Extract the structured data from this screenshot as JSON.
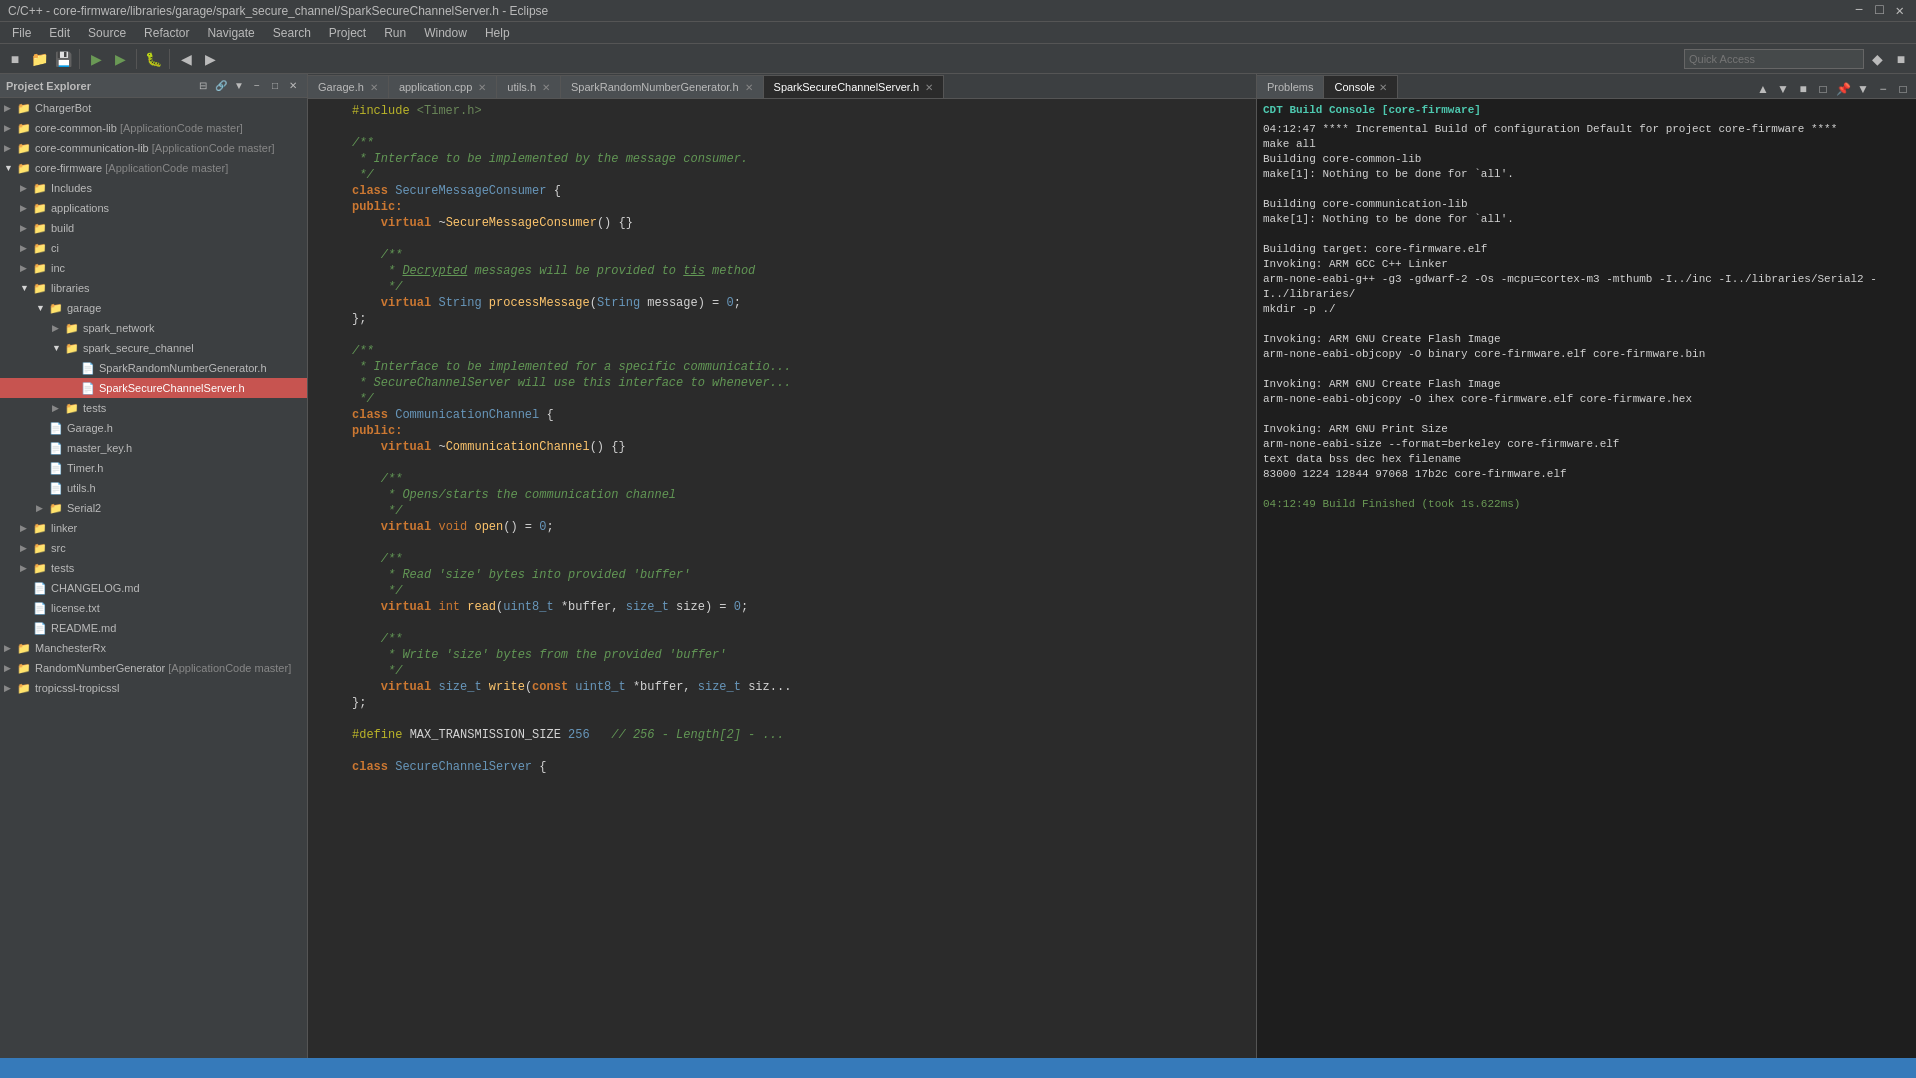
{
  "titleBar": {
    "text": "C/C++ - core-firmware/libraries/garage/spark_secure_channel/SparkSecureChannelServer.h - Eclipse",
    "controls": [
      "minimize",
      "maximize",
      "close"
    ]
  },
  "menuBar": {
    "items": [
      "File",
      "Edit",
      "Source",
      "Refactor",
      "Navigate",
      "Search",
      "Project",
      "Run",
      "Window",
      "Help"
    ]
  },
  "quickAccess": {
    "placeholder": "Quick Access"
  },
  "projectExplorer": {
    "title": "Project Explorer",
    "items": [
      {
        "label": "ChargerBot",
        "indent": 0,
        "type": "project",
        "expanded": false
      },
      {
        "label": "core-common-lib [ApplicationCode master]",
        "indent": 0,
        "type": "project",
        "expanded": false
      },
      {
        "label": "core-communication-lib [ApplicationCode master]",
        "indent": 0,
        "type": "project",
        "expanded": false
      },
      {
        "label": "core-firmware [ApplicationCode master]",
        "indent": 0,
        "type": "project",
        "expanded": true
      },
      {
        "label": "Includes",
        "indent": 1,
        "type": "folder",
        "expanded": false
      },
      {
        "label": "applications",
        "indent": 1,
        "type": "folder",
        "expanded": false
      },
      {
        "label": "build",
        "indent": 1,
        "type": "folder",
        "expanded": false
      },
      {
        "label": "ci",
        "indent": 1,
        "type": "folder",
        "expanded": false
      },
      {
        "label": "inc",
        "indent": 1,
        "type": "folder",
        "expanded": false
      },
      {
        "label": "libraries",
        "indent": 1,
        "type": "folder",
        "expanded": true
      },
      {
        "label": "garage",
        "indent": 2,
        "type": "folder",
        "expanded": true
      },
      {
        "label": "spark_network",
        "indent": 3,
        "type": "folder",
        "expanded": false
      },
      {
        "label": "spark_secure_channel",
        "indent": 3,
        "type": "folder",
        "expanded": true
      },
      {
        "label": "SparkRandomNumberGenerator.h",
        "indent": 4,
        "type": "file-h"
      },
      {
        "label": "SparkSecureChannelServer.h",
        "indent": 4,
        "type": "file-h",
        "active": true
      },
      {
        "label": "tests",
        "indent": 3,
        "type": "folder",
        "expanded": false
      },
      {
        "label": "Garage.h",
        "indent": 2,
        "type": "file-h"
      },
      {
        "label": "master_key.h",
        "indent": 2,
        "type": "file-h"
      },
      {
        "label": "Timer.h",
        "indent": 2,
        "type": "file-h"
      },
      {
        "label": "utils.h",
        "indent": 2,
        "type": "file-h"
      },
      {
        "label": "Serial2",
        "indent": 2,
        "type": "folder",
        "expanded": false
      },
      {
        "label": "linker",
        "indent": 1,
        "type": "folder",
        "expanded": false
      },
      {
        "label": "src",
        "indent": 1,
        "type": "folder",
        "expanded": false
      },
      {
        "label": "tests",
        "indent": 1,
        "type": "folder",
        "expanded": false
      },
      {
        "label": "CHANGELOG.md",
        "indent": 1,
        "type": "file"
      },
      {
        "label": "license.txt",
        "indent": 1,
        "type": "file"
      },
      {
        "label": "README.md",
        "indent": 1,
        "type": "file"
      },
      {
        "label": "ManchesterRx",
        "indent": 0,
        "type": "project",
        "expanded": false
      },
      {
        "label": "RandomNumberGenerator [ApplicationCode master]",
        "indent": 0,
        "type": "project",
        "expanded": false
      },
      {
        "label": "tropicssl-tropicssl",
        "indent": 0,
        "type": "project",
        "expanded": false
      }
    ]
  },
  "editorTabs": [
    {
      "label": "Garage.h",
      "active": false
    },
    {
      "label": "application.cpp",
      "active": false
    },
    {
      "label": "utils.h",
      "active": false
    },
    {
      "label": "SparkRandomNumberGenerator.h",
      "active": false
    },
    {
      "label": "SparkSecureChannelServer.h",
      "active": true
    }
  ],
  "codeLines": [
    {
      "num": "",
      "content": "#include <Timer.h>"
    },
    {
      "num": "",
      "content": ""
    },
    {
      "num": "",
      "content": "/**"
    },
    {
      "num": "",
      "content": " * Interface to be implemented by the message consumer."
    },
    {
      "num": "",
      "content": " */"
    },
    {
      "num": "",
      "content": "class SecureMessageConsumer {"
    },
    {
      "num": "",
      "content": "public:"
    },
    {
      "num": "",
      "content": "    virtual ~SecureMessageConsumer() {}"
    },
    {
      "num": "",
      "content": ""
    },
    {
      "num": "",
      "content": "    /**"
    },
    {
      "num": "",
      "content": "     * Decrypted messages will be provided to tis method"
    },
    {
      "num": "",
      "content": "     */"
    },
    {
      "num": "",
      "content": "    virtual String processMessage(String message) = 0;"
    },
    {
      "num": "",
      "content": "};"
    },
    {
      "num": "",
      "content": ""
    },
    {
      "num": "",
      "content": "/**"
    },
    {
      "num": "",
      "content": " * Interface to be implemented for a specific communicatio..."
    },
    {
      "num": "",
      "content": " * SecureChannelServer will use this interface to whenever..."
    },
    {
      "num": "",
      "content": " */"
    },
    {
      "num": "",
      "content": "class CommunicationChannel {"
    },
    {
      "num": "",
      "content": "public:"
    },
    {
      "num": "",
      "content": "    virtual ~CommunicationChannel() {}"
    },
    {
      "num": "",
      "content": ""
    },
    {
      "num": "",
      "content": "    /**"
    },
    {
      "num": "",
      "content": "     * Opens/starts the communication channel"
    },
    {
      "num": "",
      "content": "     */"
    },
    {
      "num": "",
      "content": "    virtual void open() = 0;"
    },
    {
      "num": "",
      "content": ""
    },
    {
      "num": "",
      "content": "    /**"
    },
    {
      "num": "",
      "content": "     * Read 'size' bytes into provided 'buffer'"
    },
    {
      "num": "",
      "content": "     */"
    },
    {
      "num": "",
      "content": "    virtual int read(uint8_t *buffer, size_t size) = 0;"
    },
    {
      "num": "",
      "content": ""
    },
    {
      "num": "",
      "content": "    /**"
    },
    {
      "num": "",
      "content": "     * Write 'size' bytes from the provided 'buffer'"
    },
    {
      "num": "",
      "content": "     */"
    },
    {
      "num": "",
      "content": "    virtual size_t write(const uint8_t *buffer, size_t siz..."
    },
    {
      "num": "",
      "content": "};"
    },
    {
      "num": "",
      "content": ""
    },
    {
      "num": "",
      "content": "#define MAX_TRANSMISSION_SIZE 256   // 256 - Length[2] - ..."
    },
    {
      "num": "",
      "content": ""
    },
    {
      "num": "",
      "content": "class SecureChannelServer {"
    }
  ],
  "consoleTabs": [
    {
      "label": "Problems",
      "active": false
    },
    {
      "label": "Console",
      "active": true
    }
  ],
  "consoleOutput": {
    "header": "CDT Build Console [core-firmware]",
    "lines": [
      "04:12:47 **** Incremental Build of configuration Default for project core-firmware ****",
      "make all",
      "Building core-common-lib",
      "make[1]: Nothing to be done for `all'.",
      "",
      "Building core-communication-lib",
      "make[1]: Nothing to be done for `all'.",
      "",
      "Building target: core-firmware.elf",
      "Invoking: ARM GCC C++ Linker",
      "arm-none-eabi-g++ -g3 -gdwarf-2 -Os -mcpu=cortex-m3 -mthumb  -I../inc -I../libraries/Serial2 -I../libraries/",
      "mkdir -p ./",
      "",
      "Invoking: ARM GNU Create Flash Image",
      "arm-none-eabi-objcopy -O binary core-firmware.elf core-firmware.bin",
      "",
      "Invoking: ARM GNU Create Flash Image",
      "arm-none-eabi-objcopy -O ihex core-firmware.elf core-firmware.hex",
      "",
      "Invoking: ARM GNU Print Size",
      "arm-none-eabi-size --format=berkeley core-firmware.elf",
      "   text    data     bss     dec     hex filename",
      "  83000    1224   12844   97068   17b2c core-firmware.elf",
      "",
      "04:12:49 Build Finished (took 1s.622ms)"
    ]
  }
}
